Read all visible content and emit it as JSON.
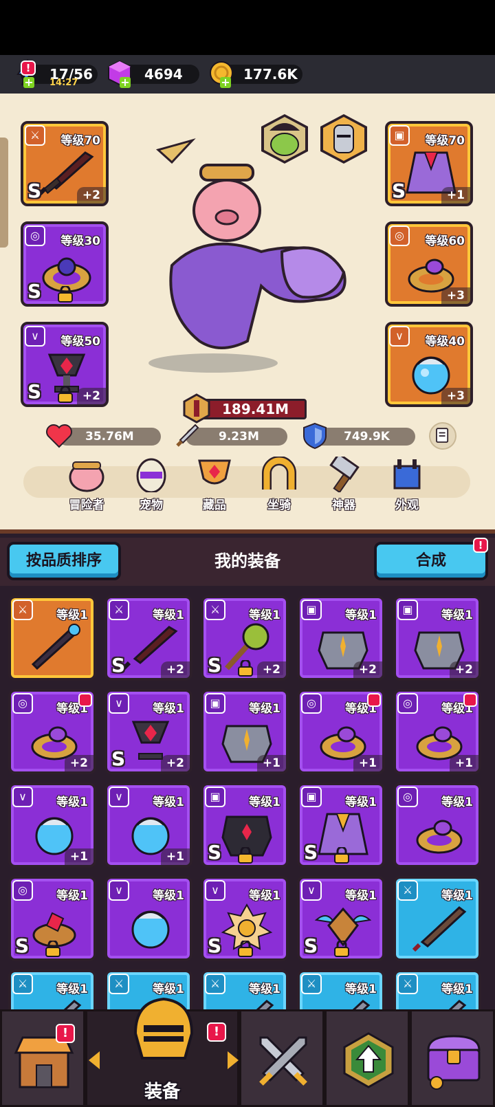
{
  "resources": {
    "energy": {
      "value": "17/56",
      "timer": "14:27"
    },
    "gems": {
      "value": "4694"
    },
    "gold": {
      "value": "177.6K"
    }
  },
  "hero": {
    "power": "189.41M",
    "hp": "35.76M",
    "attack": "9.23M",
    "defense": "749.9K",
    "slots": [
      {
        "level": "等级70",
        "plus": "+2",
        "grade": "S",
        "locked": false
      },
      {
        "level": "等级30",
        "plus": "",
        "grade": "S",
        "locked": true
      },
      {
        "level": "等级50",
        "plus": "+2",
        "grade": "S",
        "locked": true
      },
      {
        "level": "等级70",
        "plus": "+1",
        "grade": "S",
        "locked": false
      },
      {
        "level": "等级60",
        "plus": "+3",
        "grade": "",
        "locked": false
      },
      {
        "level": "等级40",
        "plus": "+3",
        "grade": "",
        "locked": false
      }
    ]
  },
  "categories": [
    "冒险者",
    "宠物",
    "藏品",
    "坐骑",
    "神器",
    "外观"
  ],
  "equipment": {
    "sort_label": "按品质排序",
    "title": "我的装备",
    "merge_label": "合成",
    "items": [
      {
        "level": "等级1",
        "plus": "",
        "grade": "",
        "locked": false
      },
      {
        "level": "等级1",
        "plus": "+2",
        "grade": "S",
        "locked": false
      },
      {
        "level": "等级1",
        "plus": "+2",
        "grade": "S",
        "locked": true
      },
      {
        "level": "等级1",
        "plus": "+2",
        "grade": "",
        "locked": false
      },
      {
        "level": "等级1",
        "plus": "+2",
        "grade": "",
        "locked": false
      },
      {
        "level": "等级1",
        "plus": "+2",
        "grade": "",
        "locked": false
      },
      {
        "level": "等级1",
        "plus": "+2",
        "grade": "S",
        "locked": false
      },
      {
        "level": "等级1",
        "plus": "+1",
        "grade": "",
        "locked": false
      },
      {
        "level": "等级1",
        "plus": "+1",
        "grade": "",
        "locked": false
      },
      {
        "level": "等级1",
        "plus": "+1",
        "grade": "",
        "locked": false
      },
      {
        "level": "等级1",
        "plus": "+1",
        "grade": "",
        "locked": false
      },
      {
        "level": "等级1",
        "plus": "+1",
        "grade": "",
        "locked": false
      },
      {
        "level": "等级1",
        "plus": "",
        "grade": "S",
        "locked": true
      },
      {
        "level": "等级1",
        "plus": "",
        "grade": "S",
        "locked": true
      },
      {
        "level": "等级1",
        "plus": "",
        "grade": "",
        "locked": false
      },
      {
        "level": "等级1",
        "plus": "",
        "grade": "S",
        "locked": true
      },
      {
        "level": "等级1",
        "plus": "",
        "grade": "",
        "locked": false
      },
      {
        "level": "等级1",
        "plus": "",
        "grade": "S",
        "locked": true
      },
      {
        "level": "等级1",
        "plus": "",
        "grade": "S",
        "locked": true
      },
      {
        "level": "等级1",
        "plus": "",
        "grade": "",
        "locked": false
      },
      {
        "level": "等级1",
        "plus": "",
        "grade": "",
        "locked": false
      },
      {
        "level": "等级1",
        "plus": "",
        "grade": "",
        "locked": false
      },
      {
        "level": "等级1",
        "plus": "",
        "grade": "",
        "locked": false
      },
      {
        "level": "等级1",
        "plus": "",
        "grade": "",
        "locked": false
      },
      {
        "level": "等级1",
        "plus": "",
        "grade": "",
        "locked": false
      }
    ]
  },
  "bottom_nav": {
    "active_label": "装备"
  },
  "colors": {
    "gold_quality": "#e07a2e",
    "purple_quality": "#8b2fd6",
    "blue_quality": "#2fb3e6",
    "panel": "#f4ead3"
  }
}
